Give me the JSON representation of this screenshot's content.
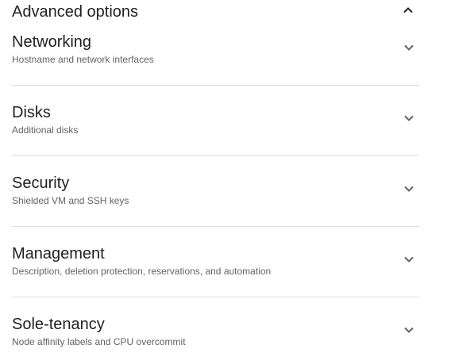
{
  "advanced": {
    "title": "Advanced options",
    "collapse_icon": "chevron-up-icon"
  },
  "sections": [
    {
      "title": "Networking",
      "description": "Hostname and network interfaces",
      "icon": "chevron-down-icon"
    },
    {
      "title": "Disks",
      "description": "Additional disks",
      "icon": "chevron-down-icon"
    },
    {
      "title": "Security",
      "description": "Shielded VM and SSH keys",
      "icon": "chevron-down-icon"
    },
    {
      "title": "Management",
      "description": "Description, deletion protection, reservations, and automation",
      "icon": "chevron-down-icon"
    },
    {
      "title": "Sole-tenancy",
      "description": "Node affinity labels and CPU overcommit",
      "icon": "chevron-down-icon"
    }
  ],
  "colors": {
    "text_primary": "#202124",
    "text_secondary": "#5f6368",
    "divider": "#dadce0"
  }
}
